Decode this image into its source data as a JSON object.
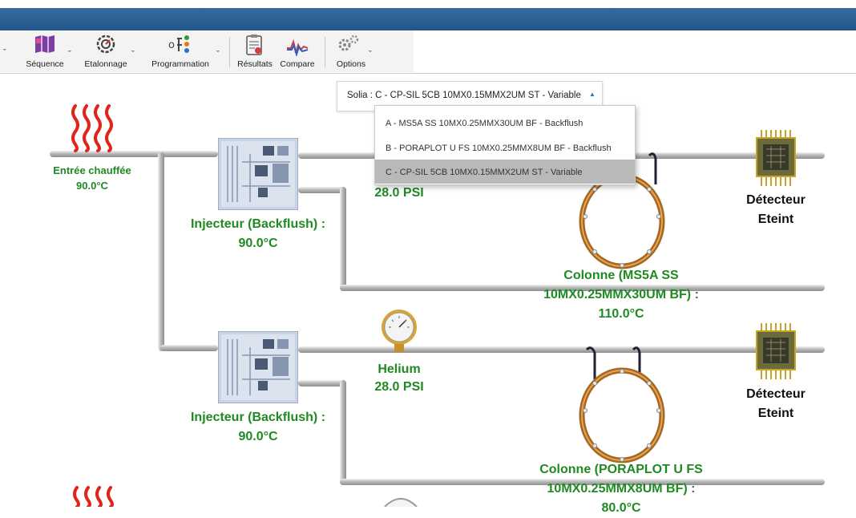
{
  "toolbar": {
    "items": [
      {
        "label": "Séquence",
        "icon": "sequence-icon"
      },
      {
        "label": "Etalonnage",
        "icon": "calibration-icon"
      },
      {
        "label": "Programmation",
        "icon": "programming-icon"
      },
      {
        "label": "Résultats",
        "icon": "results-icon"
      },
      {
        "label": "Compare",
        "icon": "compare-icon"
      },
      {
        "label": "Options",
        "icon": "options-icon"
      }
    ]
  },
  "column_selector": {
    "current": "Solia : C - CP-SIL 5CB 10MX0.15MMX2UM ST - Variable",
    "arrow": "▲",
    "options": [
      "A - MS5A SS 10MX0.25MMX30UM BF - Backflush",
      "B - PORAPLOT U FS 10MX0.25MMX8UM BF - Backflush",
      "C - CP-SIL 5CB 10MX0.15MMX2UM ST - Variable"
    ],
    "selected_index": 2
  },
  "diagram": {
    "inlet": {
      "name": "Entrée chauffée",
      "temp": "90.0°C"
    },
    "channel1": {
      "injector_name": "Injecteur (Backflush) :",
      "injector_temp": "90.0°C",
      "pressure": "28.0 PSI",
      "column_line1": "Colonne (MS5A SS",
      "column_line2": "10MX0.25MMX30UM BF) :",
      "column_temp": "110.0°C",
      "detector_line1": "Détecteur",
      "detector_line2": "Eteint"
    },
    "channel2": {
      "injector_name": "Injecteur (Backflush) :",
      "injector_temp": "90.0°C",
      "gas": "Helium",
      "pressure": "28.0 PSI",
      "column_line1": "Colonne (PORAPLOT U FS",
      "column_line2": "10MX0.25MMX8UM BF) :",
      "column_temp": "80.0°C",
      "detector_line1": "Détecteur",
      "detector_line2": "Eteint"
    }
  },
  "colors": {
    "accent": "#1f8a22",
    "titlebar": "#2c5f94",
    "coil": "#c8872e"
  }
}
